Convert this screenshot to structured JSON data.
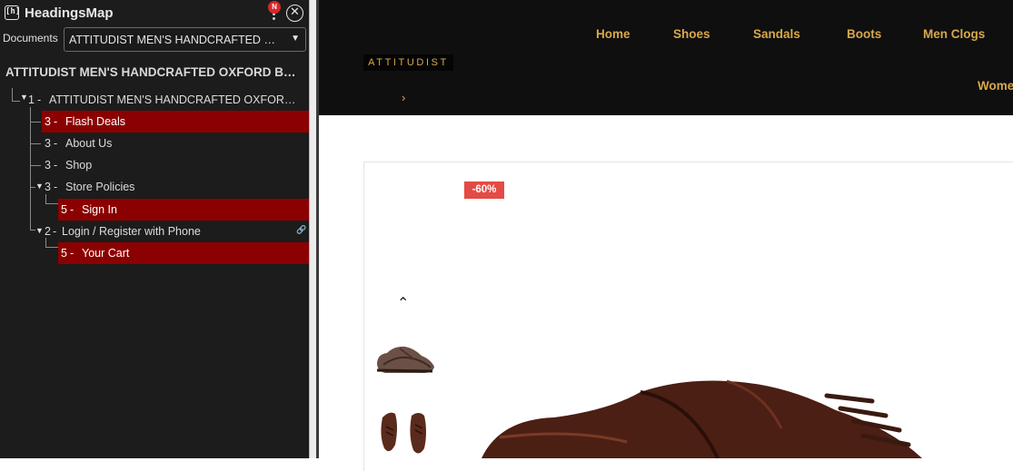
{
  "headingsmap": {
    "title": "HeadingsMap",
    "logo_text": "[h]",
    "notification_badge": "N",
    "close_glyph": "✕",
    "documents_label": "Documents",
    "document_selected": "ATTITUDIST MEN'S HANDCRAFTED OXFORD BROWN SHOES",
    "dropdown_arrow": "▼",
    "root_heading": "ATTITUDIST MEN'S HANDCRAFTED OXFORD BROWN SHOES",
    "tree": [
      {
        "level": "1",
        "label": "ATTITUDIST MEN'S HANDCRAFTED OXFORD BROWN SHOES",
        "highlighted": false
      },
      {
        "level": "3",
        "label": "Flash Deals",
        "highlighted": true
      },
      {
        "level": "3",
        "label": "About Us",
        "highlighted": false
      },
      {
        "level": "3",
        "label": "Shop",
        "highlighted": false
      },
      {
        "level": "3",
        "label": "Store Policies",
        "highlighted": false
      },
      {
        "level": "5",
        "label": "Sign In",
        "highlighted": true
      },
      {
        "level": "2",
        "label": "Login / Register with Phone",
        "highlighted": false
      },
      {
        "level": "5",
        "label": "Your Cart",
        "highlighted": true
      }
    ],
    "highlight_color": "#8b0000"
  },
  "site": {
    "nav": [
      "Home",
      "Shoes",
      "Sandals",
      "Boots",
      "Men Clogs"
    ],
    "nav_overflow": "Wome",
    "brand": "ATTITUDIST",
    "chevron": "›",
    "accent_color": "#d8a84a",
    "header_bg": "#0f0f0f"
  },
  "product": {
    "discount": "-60%",
    "thumb_up": "⌃",
    "thumbnails": [
      "brown oxford shoe side view",
      "brown oxford shoe pair top view"
    ],
    "badge_color": "#e34b44"
  }
}
